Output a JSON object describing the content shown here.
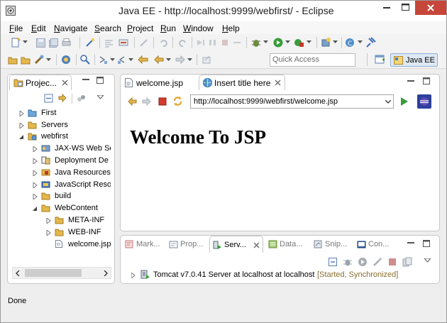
{
  "window": {
    "title": "Java EE - http://localhost:9999/webfirst/ - Eclipse",
    "controls": {
      "minimize": "minimize-icon",
      "maximize": "maximize-icon",
      "close": "close-icon"
    },
    "close_color": "#c7463a"
  },
  "menu": [
    "File",
    "Edit",
    "Navigate",
    "Search",
    "Project",
    "Run",
    "Window",
    "Help"
  ],
  "toolbar": {
    "quick_access_placeholder": "Quick Access",
    "perspective_label": "Java EE"
  },
  "project_explorer": {
    "tab_label": "Projec...",
    "tree": [
      {
        "label": "First",
        "icon": "project-folder-icon",
        "expanded": false
      },
      {
        "label": "Servers",
        "icon": "folder-icon",
        "expanded": false
      },
      {
        "label": "webfirst",
        "icon": "web-project-icon",
        "expanded": true
      },
      {
        "label": "JAX-WS Web Se",
        "icon": "jaxws-icon",
        "expanded": false
      },
      {
        "label": "Deployment De",
        "icon": "deployment-descriptor-icon",
        "expanded": false
      },
      {
        "label": "Java Resources",
        "icon": "java-resources-icon",
        "expanded": false
      },
      {
        "label": "JavaScript Reso",
        "icon": "javascript-resources-icon",
        "expanded": false
      },
      {
        "label": "build",
        "icon": "folder-icon",
        "expanded": false
      },
      {
        "label": "WebContent",
        "icon": "folder-icon",
        "expanded": true
      },
      {
        "label": "META-INF",
        "icon": "folder-icon",
        "expanded": false
      },
      {
        "label": "WEB-INF",
        "icon": "folder-icon",
        "expanded": false
      },
      {
        "label": "welcome.jsp",
        "icon": "jsp-file-icon",
        "expanded": false
      }
    ]
  },
  "editor": {
    "tabs": [
      {
        "label": "welcome.jsp",
        "icon": "jsp-file-icon"
      },
      {
        "label": "Insert title here",
        "icon": "globe-icon"
      }
    ],
    "url": "http://localhost:9999/webfirst/welcome.jsp",
    "heading": "Welcome To JSP"
  },
  "bottom_panel": {
    "tabs": [
      "Mark...",
      "Prop...",
      "Serv...",
      "Data...",
      "Snip...",
      "Con..."
    ],
    "server_row": {
      "label": "Tomcat v7.0.41 Server at localhost at localhost",
      "status": "[Started, Synchronized]",
      "status_color": "#8a6d2f"
    }
  },
  "status_bar": {
    "text": "Done"
  },
  "colors": {
    "accent_blue": "#2a6ebb",
    "heading": "#000000"
  }
}
